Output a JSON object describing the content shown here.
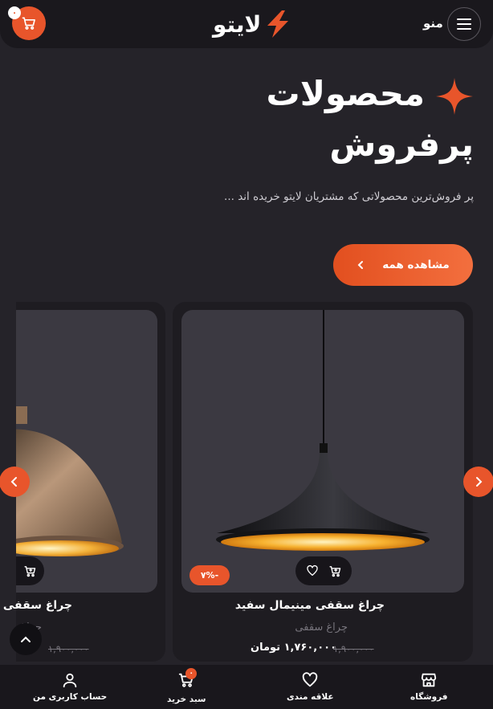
{
  "header": {
    "cart_count": "۰",
    "logo_text": "لایتو",
    "menu_label": "منو"
  },
  "hero": {
    "title_line1": "محصولات",
    "title_line2": "پرفروش",
    "subtitle": "پر فروش‌ترین محصولاتی که مشتریان لایتو خریده اند ...",
    "view_all_label": "مشاهده همه"
  },
  "products": [
    {
      "name": "چراغ سقفی مینیمال سفید",
      "category": "چراغ سقفی",
      "old_price": "۱,۹۰۰,۰۰۰",
      "price": "۱,۷۶۰,۰۰۰ تومان",
      "discount": "۷%-"
    },
    {
      "name": "چراغ سقفی",
      "category": "چراغ",
      "old_price": "۱,۹۰۰,۰۰۰"
    }
  ],
  "bottom_nav": {
    "items": [
      {
        "label": "فروشگاه",
        "icon": "store-icon"
      },
      {
        "label": "علاقه مندی",
        "icon": "heart-icon"
      },
      {
        "label": "سبد خرید",
        "icon": "cart-icon",
        "badge": "۰"
      },
      {
        "label": "حساب کاربری من",
        "icon": "user-icon"
      }
    ]
  },
  "colors": {
    "accent": "#e8552b",
    "background": "#252329",
    "card": "#1e1c21"
  }
}
